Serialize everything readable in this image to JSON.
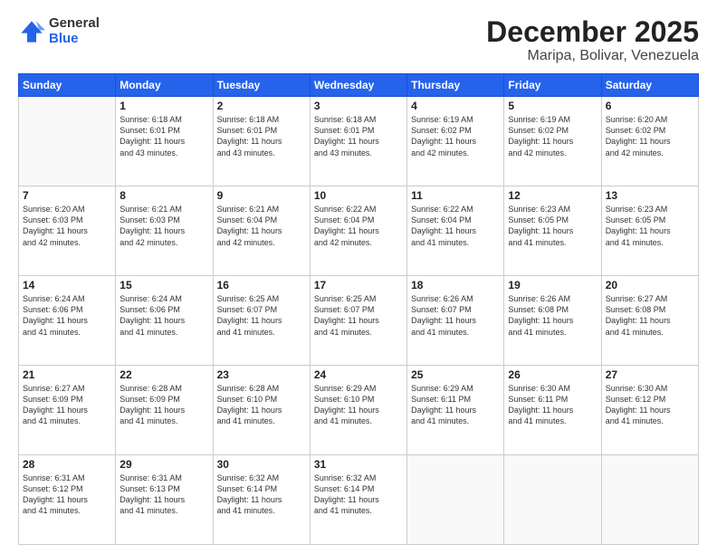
{
  "header": {
    "logo_general": "General",
    "logo_blue": "Blue",
    "title": "December 2025",
    "subtitle": "Maripa, Bolivar, Venezuela"
  },
  "calendar": {
    "days_of_week": [
      "Sunday",
      "Monday",
      "Tuesday",
      "Wednesday",
      "Thursday",
      "Friday",
      "Saturday"
    ],
    "weeks": [
      [
        {
          "day": "",
          "info": ""
        },
        {
          "day": "1",
          "info": "Sunrise: 6:18 AM\nSunset: 6:01 PM\nDaylight: 11 hours\nand 43 minutes."
        },
        {
          "day": "2",
          "info": "Sunrise: 6:18 AM\nSunset: 6:01 PM\nDaylight: 11 hours\nand 43 minutes."
        },
        {
          "day": "3",
          "info": "Sunrise: 6:18 AM\nSunset: 6:01 PM\nDaylight: 11 hours\nand 43 minutes."
        },
        {
          "day": "4",
          "info": "Sunrise: 6:19 AM\nSunset: 6:02 PM\nDaylight: 11 hours\nand 42 minutes."
        },
        {
          "day": "5",
          "info": "Sunrise: 6:19 AM\nSunset: 6:02 PM\nDaylight: 11 hours\nand 42 minutes."
        },
        {
          "day": "6",
          "info": "Sunrise: 6:20 AM\nSunset: 6:02 PM\nDaylight: 11 hours\nand 42 minutes."
        }
      ],
      [
        {
          "day": "7",
          "info": "Sunrise: 6:20 AM\nSunset: 6:03 PM\nDaylight: 11 hours\nand 42 minutes."
        },
        {
          "day": "8",
          "info": "Sunrise: 6:21 AM\nSunset: 6:03 PM\nDaylight: 11 hours\nand 42 minutes."
        },
        {
          "day": "9",
          "info": "Sunrise: 6:21 AM\nSunset: 6:04 PM\nDaylight: 11 hours\nand 42 minutes."
        },
        {
          "day": "10",
          "info": "Sunrise: 6:22 AM\nSunset: 6:04 PM\nDaylight: 11 hours\nand 42 minutes."
        },
        {
          "day": "11",
          "info": "Sunrise: 6:22 AM\nSunset: 6:04 PM\nDaylight: 11 hours\nand 41 minutes."
        },
        {
          "day": "12",
          "info": "Sunrise: 6:23 AM\nSunset: 6:05 PM\nDaylight: 11 hours\nand 41 minutes."
        },
        {
          "day": "13",
          "info": "Sunrise: 6:23 AM\nSunset: 6:05 PM\nDaylight: 11 hours\nand 41 minutes."
        }
      ],
      [
        {
          "day": "14",
          "info": "Sunrise: 6:24 AM\nSunset: 6:06 PM\nDaylight: 11 hours\nand 41 minutes."
        },
        {
          "day": "15",
          "info": "Sunrise: 6:24 AM\nSunset: 6:06 PM\nDaylight: 11 hours\nand 41 minutes."
        },
        {
          "day": "16",
          "info": "Sunrise: 6:25 AM\nSunset: 6:07 PM\nDaylight: 11 hours\nand 41 minutes."
        },
        {
          "day": "17",
          "info": "Sunrise: 6:25 AM\nSunset: 6:07 PM\nDaylight: 11 hours\nand 41 minutes."
        },
        {
          "day": "18",
          "info": "Sunrise: 6:26 AM\nSunset: 6:07 PM\nDaylight: 11 hours\nand 41 minutes."
        },
        {
          "day": "19",
          "info": "Sunrise: 6:26 AM\nSunset: 6:08 PM\nDaylight: 11 hours\nand 41 minutes."
        },
        {
          "day": "20",
          "info": "Sunrise: 6:27 AM\nSunset: 6:08 PM\nDaylight: 11 hours\nand 41 minutes."
        }
      ],
      [
        {
          "day": "21",
          "info": "Sunrise: 6:27 AM\nSunset: 6:09 PM\nDaylight: 11 hours\nand 41 minutes."
        },
        {
          "day": "22",
          "info": "Sunrise: 6:28 AM\nSunset: 6:09 PM\nDaylight: 11 hours\nand 41 minutes."
        },
        {
          "day": "23",
          "info": "Sunrise: 6:28 AM\nSunset: 6:10 PM\nDaylight: 11 hours\nand 41 minutes."
        },
        {
          "day": "24",
          "info": "Sunrise: 6:29 AM\nSunset: 6:10 PM\nDaylight: 11 hours\nand 41 minutes."
        },
        {
          "day": "25",
          "info": "Sunrise: 6:29 AM\nSunset: 6:11 PM\nDaylight: 11 hours\nand 41 minutes."
        },
        {
          "day": "26",
          "info": "Sunrise: 6:30 AM\nSunset: 6:11 PM\nDaylight: 11 hours\nand 41 minutes."
        },
        {
          "day": "27",
          "info": "Sunrise: 6:30 AM\nSunset: 6:12 PM\nDaylight: 11 hours\nand 41 minutes."
        }
      ],
      [
        {
          "day": "28",
          "info": "Sunrise: 6:31 AM\nSunset: 6:12 PM\nDaylight: 11 hours\nand 41 minutes."
        },
        {
          "day": "29",
          "info": "Sunrise: 6:31 AM\nSunset: 6:13 PM\nDaylight: 11 hours\nand 41 minutes."
        },
        {
          "day": "30",
          "info": "Sunrise: 6:32 AM\nSunset: 6:14 PM\nDaylight: 11 hours\nand 41 minutes."
        },
        {
          "day": "31",
          "info": "Sunrise: 6:32 AM\nSunset: 6:14 PM\nDaylight: 11 hours\nand 41 minutes."
        },
        {
          "day": "",
          "info": ""
        },
        {
          "day": "",
          "info": ""
        },
        {
          "day": "",
          "info": ""
        }
      ]
    ]
  }
}
